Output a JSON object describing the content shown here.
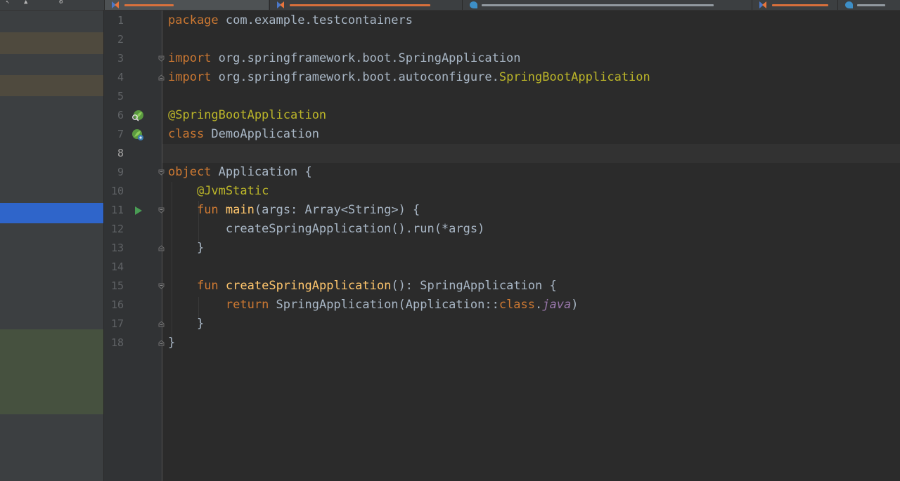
{
  "tabs": [
    {
      "icon": "kotlin-file-icon",
      "active": true
    },
    {
      "icon": "kotlin-file-icon",
      "active": false
    },
    {
      "icon": "intellij-class-icon",
      "active": false
    },
    {
      "icon": "kotlin-file-icon",
      "active": false
    },
    {
      "icon": "intellij-class-icon",
      "active": false
    }
  ],
  "editor": {
    "current_line": 8,
    "lines": [
      {
        "n": "1",
        "tokens": [
          {
            "t": "package",
            "c": "kw"
          },
          {
            "t": " com.example.testcontainers",
            "c": "plain"
          }
        ]
      },
      {
        "n": "2",
        "tokens": []
      },
      {
        "n": "3",
        "tokens": [
          {
            "t": "import",
            "c": "kw"
          },
          {
            "t": " org.springframework.boot.SpringApplication",
            "c": "plain"
          }
        ]
      },
      {
        "n": "4",
        "tokens": [
          {
            "t": "import",
            "c": "kw"
          },
          {
            "t": " org.springframework.boot.autoconfigure.",
            "c": "plain"
          },
          {
            "t": "SpringBootApplication",
            "c": "ann"
          }
        ]
      },
      {
        "n": "5",
        "tokens": []
      },
      {
        "n": "6",
        "tokens": [
          {
            "t": "@SpringBootApplication",
            "c": "ann"
          }
        ]
      },
      {
        "n": "7",
        "tokens": [
          {
            "t": "class",
            "c": "kw"
          },
          {
            "t": " DemoApplication",
            "c": "plain"
          }
        ]
      },
      {
        "n": "8",
        "tokens": []
      },
      {
        "n": "9",
        "tokens": [
          {
            "t": "object",
            "c": "kw"
          },
          {
            "t": " Application {",
            "c": "plain"
          }
        ]
      },
      {
        "n": "10",
        "tokens": [
          {
            "t": "    ",
            "c": "plain"
          },
          {
            "t": "@JvmStatic",
            "c": "ann"
          }
        ]
      },
      {
        "n": "11",
        "tokens": [
          {
            "t": "    ",
            "c": "plain"
          },
          {
            "t": "fun",
            "c": "kw"
          },
          {
            "t": " ",
            "c": "plain"
          },
          {
            "t": "main",
            "c": "fn"
          },
          {
            "t": "(args: Array<String>) {",
            "c": "plain"
          }
        ]
      },
      {
        "n": "12",
        "tokens": [
          {
            "t": "        createSpringApplication().run(*args)",
            "c": "plain"
          }
        ]
      },
      {
        "n": "13",
        "tokens": [
          {
            "t": "    }",
            "c": "plain"
          }
        ]
      },
      {
        "n": "14",
        "tokens": []
      },
      {
        "n": "15",
        "tokens": [
          {
            "t": "    ",
            "c": "plain"
          },
          {
            "t": "fun",
            "c": "kw"
          },
          {
            "t": " ",
            "c": "plain"
          },
          {
            "t": "createSpringApplication",
            "c": "fn"
          },
          {
            "t": "(): SpringApplication {",
            "c": "plain"
          }
        ]
      },
      {
        "n": "16",
        "tokens": [
          {
            "t": "        ",
            "c": "plain"
          },
          {
            "t": "return",
            "c": "kw"
          },
          {
            "t": " SpringApplication(Application::",
            "c": "plain"
          },
          {
            "t": "class",
            "c": "kw"
          },
          {
            "t": ".",
            "c": "plain"
          },
          {
            "t": "java",
            "c": "it"
          },
          {
            "t": ")",
            "c": "plain"
          }
        ]
      },
      {
        "n": "17",
        "tokens": [
          {
            "t": "    }",
            "c": "plain"
          }
        ]
      },
      {
        "n": "18",
        "tokens": [
          {
            "t": "}",
            "c": "plain"
          }
        ]
      }
    ]
  },
  "gutter_icons": [
    {
      "line": 6,
      "icon": "spring-bean-search-icon"
    },
    {
      "line": 7,
      "icon": "spring-bean-navigate-icon"
    },
    {
      "line": 11,
      "icon": "run-icon"
    }
  ],
  "fold_markers": [
    {
      "line": 3,
      "kind": "start"
    },
    {
      "line": 4,
      "kind": "end"
    },
    {
      "line": 9,
      "kind": "start"
    },
    {
      "line": 11,
      "kind": "start"
    },
    {
      "line": 13,
      "kind": "end"
    },
    {
      "line": 15,
      "kind": "start"
    },
    {
      "line": 17,
      "kind": "end"
    },
    {
      "line": 18,
      "kind": "end"
    }
  ],
  "project_panel": {
    "rows": [
      {
        "state": "modified"
      },
      {
        "state": "modified"
      },
      {
        "state": "selected"
      },
      {
        "state": "added"
      }
    ]
  },
  "colors": {
    "editor_bg": "#2b2b2b",
    "keyword": "#cc7832",
    "annotation": "#bbb529",
    "function": "#ffc66d",
    "plain": "#a9b7c6",
    "italic_field": "#9876aa",
    "selection": "#2f65ca",
    "modified_row": "#4f4a3e",
    "added_row": "#46513f"
  }
}
